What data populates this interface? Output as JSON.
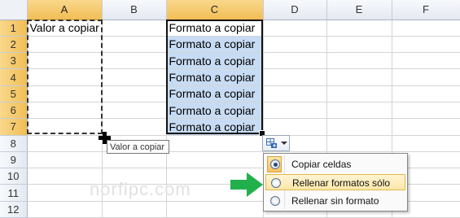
{
  "columns": [
    "A",
    "B",
    "C",
    "D",
    "E",
    "F"
  ],
  "rows": [
    "1",
    "2",
    "3",
    "4",
    "5",
    "6",
    "7",
    "8",
    "9",
    "10",
    "11",
    "12"
  ],
  "cells": {
    "A1": "Valor a copiar",
    "C1": "Formato a copiar",
    "C2": "Formato a copiar",
    "C3": "Formato a copiar",
    "C4": "Formato a copiar",
    "C5": "Formato a copiar",
    "C6": "Formato a copiar",
    "C7": "Formato a copiar"
  },
  "tooltip": "Valor a copiar",
  "autofill_menu": {
    "items": [
      {
        "label": "Copiar celdas",
        "checked": true
      },
      {
        "label": "Rellenar formatos sólo",
        "checked": false,
        "hover": true
      },
      {
        "label": "Rellenar sin formato",
        "checked": false
      }
    ]
  },
  "watermark": "norfipc.com",
  "colors": {
    "selection_fill": "#c7dcf4",
    "header_selected": "#f2bd55",
    "arrow": "#22b04c"
  },
  "icons": [
    "fill-handle-cross-icon",
    "auto-fill-options-icon",
    "dropdown-arrow-icon",
    "green-arrow-icon"
  ]
}
